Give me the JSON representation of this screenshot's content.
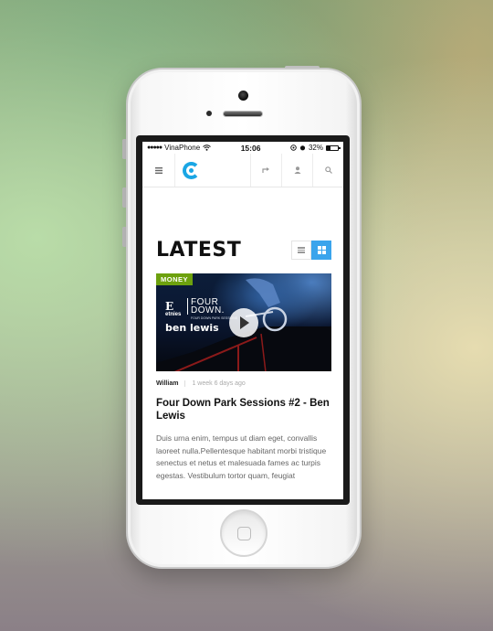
{
  "status_bar": {
    "signal": "●●●●●",
    "carrier": "VinaPhone",
    "wifi_icon": "wifi-icon",
    "time": "15:06",
    "battery_percent": "32%"
  },
  "app_bar": {
    "menu_icon": "menu-icon",
    "logo": "brand-logo",
    "share_icon": "share-icon",
    "user_icon": "user-icon",
    "search_icon": "search-icon"
  },
  "section": {
    "title": "LATEST",
    "views": [
      "list",
      "grid"
    ],
    "active_view": "grid"
  },
  "post": {
    "category": "MONEY",
    "thumbnail": {
      "brand": "etnies",
      "line1": "FOUR",
      "line2": "DOWN.",
      "subline": "FOUR DOWN PARK SESSIONS",
      "name": "ben lewis"
    },
    "author": "William",
    "date": "1 week 6 days ago",
    "title": "Four Down Park Sessions #2 - Ben Lewis",
    "excerpt": "Duis urna enim, tempus ut diam eget, convallis laoreet nulla.Pellentesque habitant morbi tristique senectus et netus et malesuada fames ac turpis egestas. Vestibulum tortor quam, feugiat"
  },
  "colors": {
    "accent": "#1aa6e4",
    "toggle_active": "#3aa4ec",
    "category_badge": "#6da10e"
  }
}
